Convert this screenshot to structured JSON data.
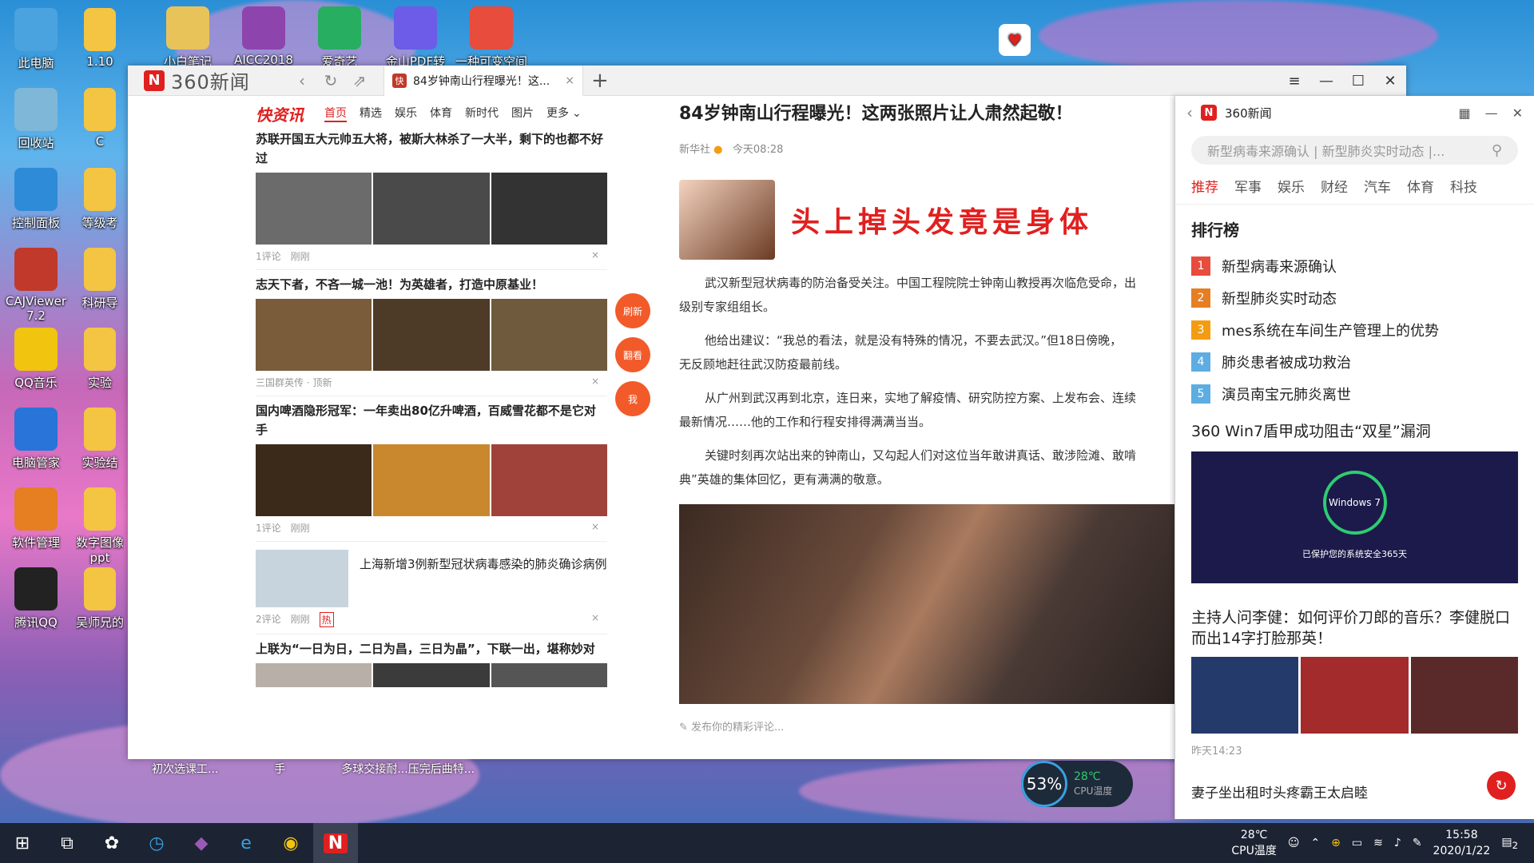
{
  "desktop": {
    "icons": [
      {
        "label": "此电脑",
        "color": "#4aa3df"
      },
      {
        "label": "回收站",
        "color": "#7fb7d9"
      },
      {
        "label": "控制面板",
        "color": "#2e8bd8"
      },
      {
        "label": "CAJViewer 7.2",
        "color": "#c0392b"
      },
      {
        "label": "QQ音乐",
        "color": "#f1c40f"
      },
      {
        "label": "电脑管家",
        "color": "#2874d8"
      },
      {
        "label": "软件管理",
        "color": "#e67e22"
      },
      {
        "label": "腾讯QQ",
        "color": "#222222"
      }
    ],
    "icons_col2": [
      "1.10",
      "C",
      "等级考",
      "科研导",
      "实验",
      "实验结",
      "数字图像 ppt",
      "吴师兄的"
    ],
    "icons_top": [
      "小白笔记",
      "AICC2018",
      "爱奇艺",
      "金山PDF转",
      "一种可变空间"
    ]
  },
  "window": {
    "brand": "360新闻",
    "tab_title": "84岁钟南山行程曝光！这...",
    "feed": {
      "logo": "快资讯",
      "tabs": [
        "首页",
        "精选",
        "娱乐",
        "体育",
        "新时代",
        "图片",
        "更多"
      ],
      "items": [
        {
          "title": "苏联开国五大元帅五大将，被斯大林杀了一大半，剩下的也都不好过",
          "meta1": "1评论",
          "meta2": "刚刚"
        },
        {
          "title": "志天下者，不吝一城一池！为英雄者，打造中原基业！",
          "meta1": "三国群英传 · 顶新",
          "meta2": ""
        },
        {
          "title": "国内啤酒隐形冠军：一年卖出80亿升啤酒，百威雪花都不是它对手",
          "meta1": "1评论",
          "meta2": "刚刚"
        },
        {
          "title": "上海新增3例新型冠状病毒感染的肺炎确诊病例",
          "meta1": "2评论",
          "meta2": "刚刚",
          "badge": "热"
        },
        {
          "title": "上联为“一日为日，二日为昌，三日为晶”，下联一出，堪称妙对",
          "meta1": "",
          "meta2": ""
        }
      ]
    },
    "article": {
      "title": "84岁钟南山行程曝光！这两张照片让人肃然起敬！",
      "source": "新华社",
      "time": "今天08:28",
      "banner": "头上掉头发竟是身体",
      "paras": [
        "武汉新型冠状病毒的防治备受关注。中国工程院院士钟南山教授再次临危受命，出",
        "级别专家组组长。",
        "他给出建议：“我总的看法，就是没有特殊的情况，不要去武汉。”但18日傍晚，",
        "无反顾地赶往武汉防疫最前线。",
        "从广州到武汉再到北京，连日来，实地了解疫情、研究防控方案、上发布会、连续",
        "最新情况……他的工作和行程安排得满满当当。",
        "关键时刻再次站出来的钟南山，又勾起人们对这位当年敢讲真话、敢涉险滩、敢啃",
        "典”英雄的集体回忆，更有满满的敬意。"
      ],
      "comment_placeholder": "发布你的精彩评论..."
    },
    "float_buttons": [
      "刷新",
      "翻看",
      "我"
    ]
  },
  "panel": {
    "title": "360新闻",
    "search_placeholder": "新型病毒来源确认 | 新型肺炎实时动态 |...",
    "tabs": [
      "推荐",
      "军事",
      "娱乐",
      "财经",
      "汽车",
      "体育",
      "科技"
    ],
    "rank_title": "排行榜",
    "rank": [
      {
        "n": "1",
        "text": "新型病毒来源确认",
        "color": "#e74c3c"
      },
      {
        "n": "2",
        "text": "新型肺炎实时动态",
        "color": "#e67e22"
      },
      {
        "n": "3",
        "text": "mes系统在车间生产管理上的优势",
        "color": "#f39c12"
      },
      {
        "n": "4",
        "text": "肺炎患者被成功救治",
        "color": "#5dade2"
      },
      {
        "n": "5",
        "text": "演员南宝元肺炎离世",
        "color": "#5dade2"
      }
    ],
    "news1": "360 Win7盾甲成功阻击“双星”漏洞",
    "win7_text": "Windows 7",
    "win7_caption": "已保护您的系统安全365天",
    "news2": "主持人问李健：如何评价刀郎的音乐？李健脱口而出14字打脸那英！",
    "news2_time": "昨天14:23",
    "news3": "妻子坐出租时头疼霸王太启睦"
  },
  "cpu_widget": {
    "percent": "53%",
    "temp": "28℃",
    "label": "CPU温度"
  },
  "taskbar": {
    "inactive": [
      "初次选课工...",
      "手",
      "多球交接耐...压完后曲特..."
    ],
    "temp": "28℃",
    "temp_label": "CPU温度",
    "time": "15:58",
    "date": "2020/1/22",
    "notify": "2"
  }
}
